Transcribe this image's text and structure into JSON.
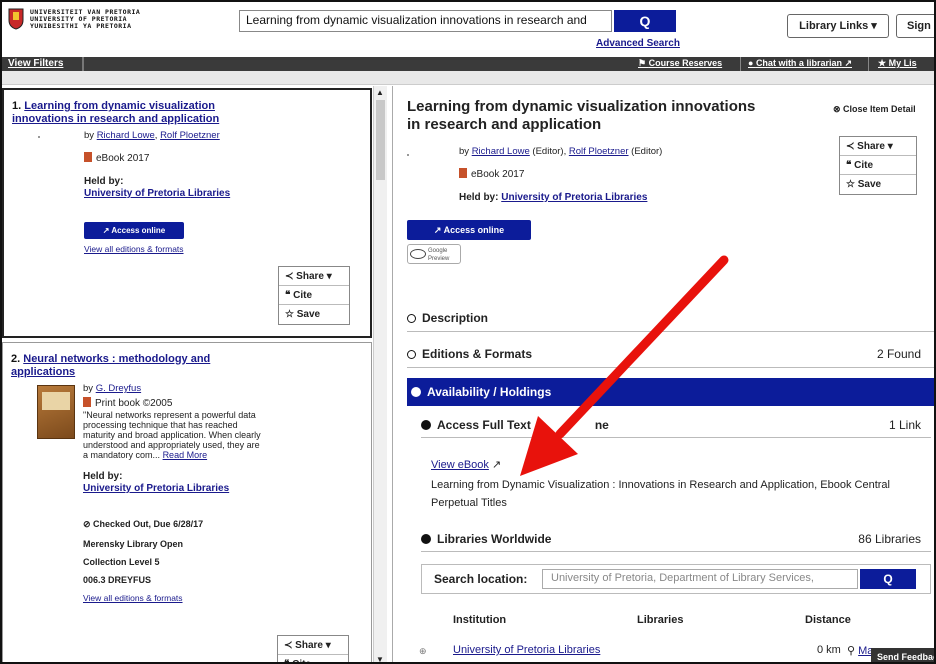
{
  "header": {
    "logo_text": [
      "UNIVERSITEIT VAN PRETORIA",
      "UNIVERSITY OF PRETORIA",
      "YUNIBESITHI YA PRETORIA"
    ],
    "search_value": "Learning from dynamic visualization innovations in research and",
    "search_button": "Q",
    "advanced_search": "Advanced Search",
    "library_links": "Library Links ▾",
    "sign_in": "Sign I"
  },
  "navbar": {
    "view_filters": "View Filters",
    "course_reserves": "Course Reserves",
    "chat": "Chat with a librarian",
    "my_list": "My Lis"
  },
  "results": [
    {
      "num": "1.",
      "title": "Learning from dynamic visualization innovations in research and application",
      "by_label": "by",
      "authors": [
        "Richard Lowe",
        "Rolf Ploetzner"
      ],
      "format": "eBook 2017",
      "held_by_label": "Held by:",
      "held_by": "University of Pretoria Libraries",
      "access": "Access online",
      "all_editions": "View all editions & formats"
    },
    {
      "num": "2.",
      "title": "Neural networks : methodology and applications",
      "by_label": "by",
      "authors": [
        "G. Dreyfus"
      ],
      "format": "Print book ©2005",
      "description": "\"Neural networks represent a powerful data processing technique that has reached maturity and broad application. When clearly understood and appropriately used, they are a mandatory com...",
      "read_more": "Read More",
      "held_by_label": "Held by:",
      "held_by": "University of Pretoria Libraries",
      "status": "Checked Out, Due 6/28/17",
      "location": "Merensky Library Open",
      "collection": "Collection Level 5",
      "call_number": "006.3 DREYFUS",
      "all_editions": "View all editions & formats"
    }
  ],
  "share_group": {
    "share": "Share ▾",
    "cite": "Cite",
    "save": "Save"
  },
  "detail": {
    "title": "Learning from dynamic visualization innovations in research and application",
    "close": "Close Item Detail",
    "by_label": "by",
    "authors": [
      "Richard Lowe",
      "Rolf Ploetzner"
    ],
    "editor_tag": "(Editor)",
    "format": "eBook 2017",
    "held_by_label": "Held by:",
    "held_by": "University of Pretoria Libraries",
    "access": "Access online",
    "google_preview": [
      "Google",
      "Preview"
    ],
    "description_label": "Description",
    "editions_label": "Editions & Formats",
    "editions_count": "2 Found",
    "availability_label": "Availability / Holdings",
    "access_full_text": "Access Full Text",
    "access_full_text_suffix": "ne",
    "link_count": "1 Link",
    "view_ebook": "View eBook",
    "ebook_description": "Learning from Dynamic Visualization : Innovations in Research and Application, Ebook Central Perpetual Titles",
    "libraries_worldwide": "Libraries Worldwide",
    "libraries_count": "86 Libraries",
    "search_location_label": "Search location:",
    "search_location_placeholder": "University of Pretoria, Department of Library Services,",
    "search_location_button": "Q",
    "col_institution": "Institution",
    "col_libraries": "Libraries",
    "col_distance": "Distance",
    "row_institution": "University of Pretoria Libraries",
    "row_distance": "0 km",
    "row_map": "Map",
    "send_feedback": "Send Feedbac"
  },
  "colors": {
    "accent": "#0c1c9a",
    "arrow": "#e8120c",
    "link": "#1a1a8c"
  },
  "icons": [
    "search-icon",
    "share-icon",
    "cite-icon",
    "star-icon",
    "external-link-icon",
    "book-icon",
    "chat-icon",
    "flag-icon",
    "eye-icon"
  ]
}
